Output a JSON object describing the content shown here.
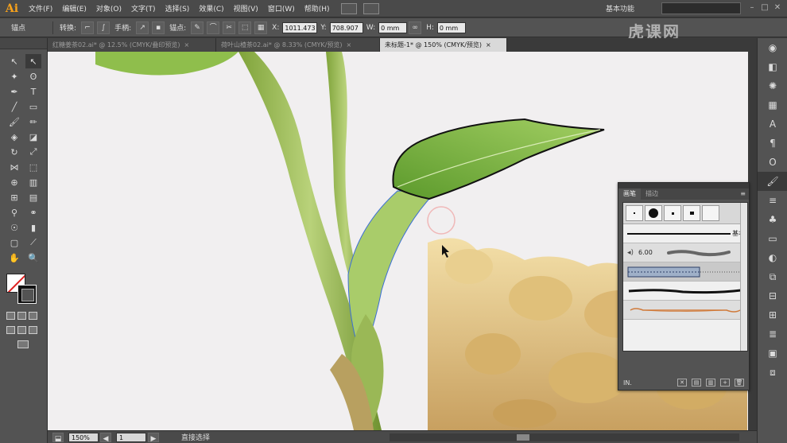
{
  "app": {
    "logo": "Ai",
    "workspace": "基本功能",
    "watermark": "虎课网"
  },
  "menu": [
    "文件(F)",
    "编辑(E)",
    "对象(O)",
    "文字(T)",
    "选择(S)",
    "效果(C)",
    "视图(V)",
    "窗口(W)",
    "帮助(H)"
  ],
  "control": {
    "anchor_label": "锚点",
    "convert_label": "转换:",
    "handle_label": "手柄:",
    "anchors_label": "锚点:",
    "x_value": "1011.473",
    "y_value": "708.907",
    "w_value": "0 mm",
    "h_value": "0 mm"
  },
  "tabs": [
    {
      "label": "红糖姜茶02.ai* @ 12.5% (CMYK/叠印预览)",
      "active": false
    },
    {
      "label": "荷叶山楂茶02.ai* @ 8.33% (CMYK/预览)",
      "active": false
    },
    {
      "label": "未标题-1* @ 150% (CMYK/预览)",
      "active": true
    }
  ],
  "status": {
    "zoom": "150%",
    "page": "1",
    "tool_name": "直接选择"
  },
  "brush_panel": {
    "tab_active": "画笔",
    "tab_inactive": "描边",
    "basic_label": "基本",
    "size_value": "6.00",
    "library_label": "IN."
  },
  "colors": {
    "accent": "#f7a21b",
    "panel": "#535353",
    "canvas": "#f1eff0"
  }
}
